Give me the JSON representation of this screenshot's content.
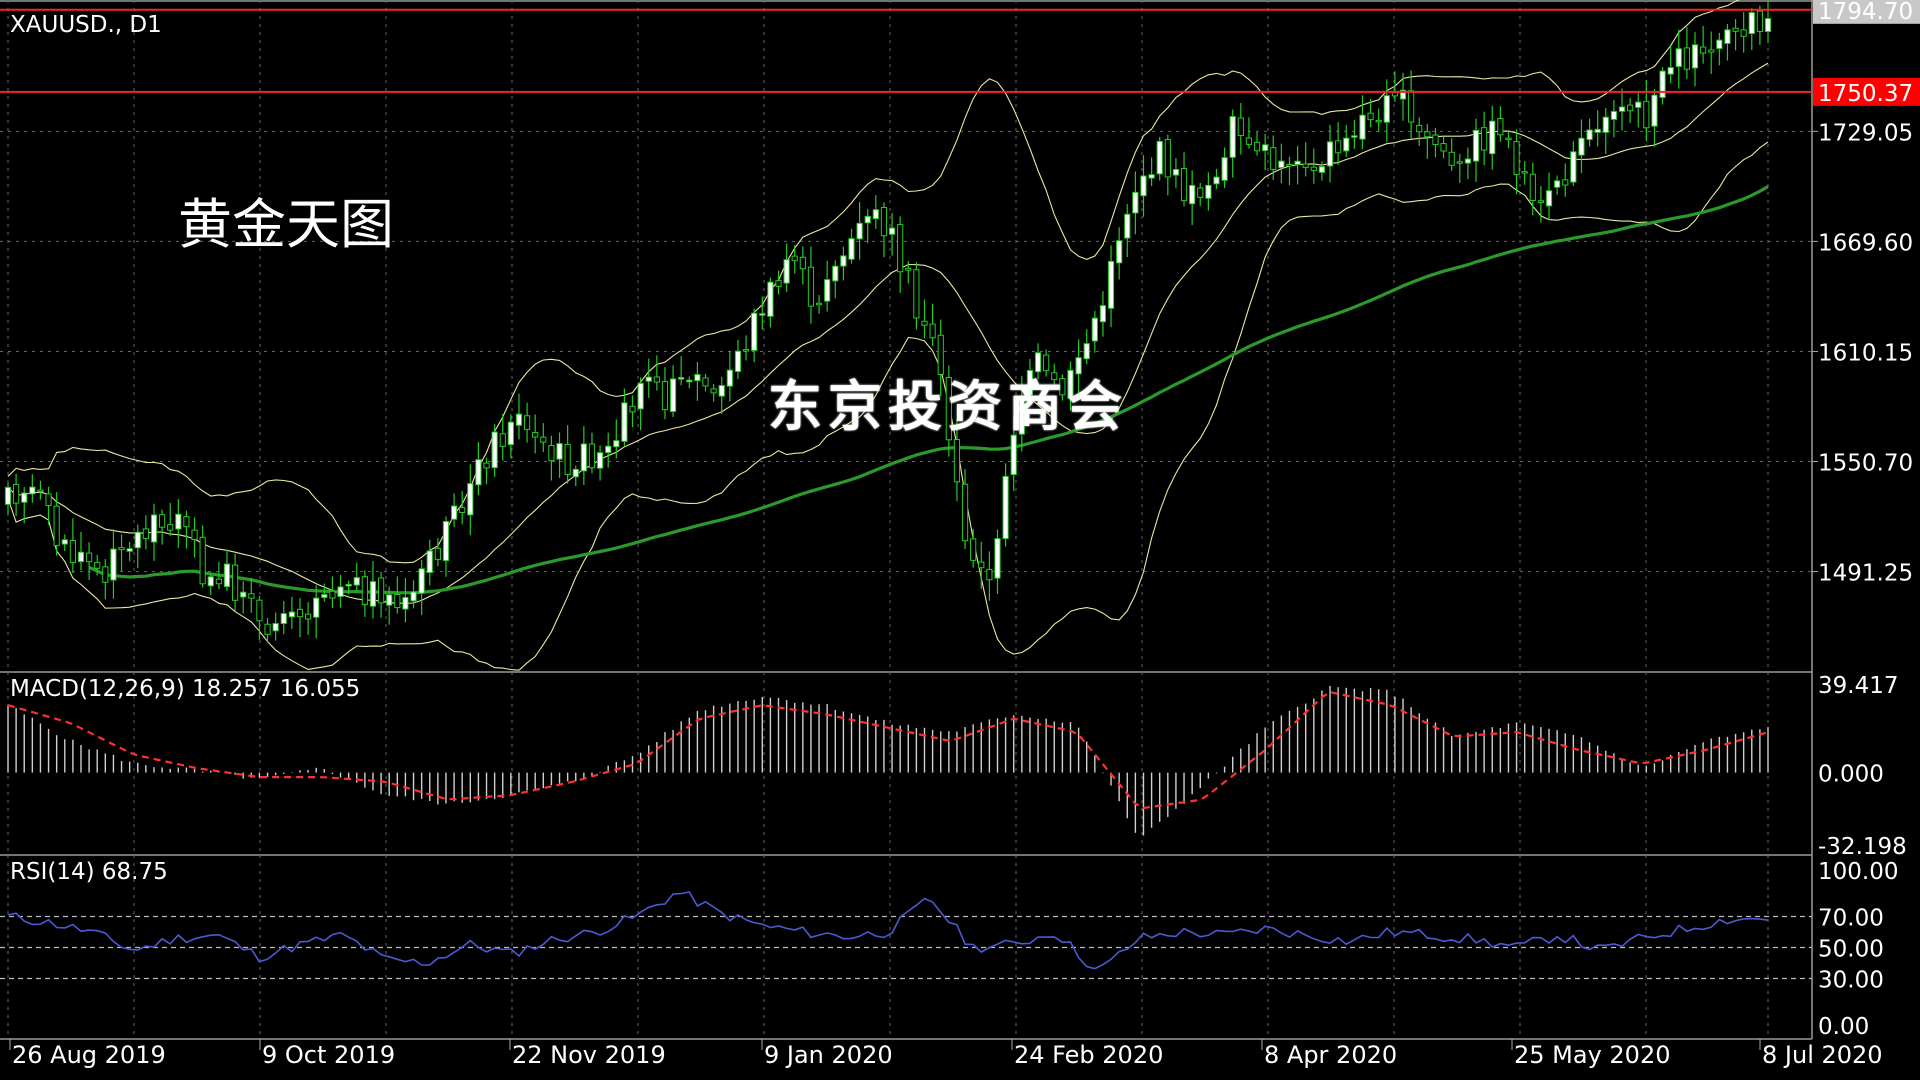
{
  "chart_data": {
    "type": "candlestick",
    "symbol_label": "XAUUSD., D1",
    "cn_title": "黄金天图",
    "watermark": "东京投资商会",
    "price_axis": {
      "labels": [
        "1729.05",
        "1669.60",
        "1610.15",
        "1550.70",
        "1491.25"
      ],
      "range": [
        1437,
        1800
      ]
    },
    "horizontal_lines": [
      {
        "label": "1794.70",
        "value": 1794.7,
        "color": "#ff2020",
        "tag_bg": "#c8c8c8",
        "tag_fg": "#000000"
      },
      {
        "label": "1750.37",
        "value": 1750.37,
        "color": "#ff2020",
        "tag_bg": "#ff0000",
        "tag_fg": "#ffffff"
      }
    ],
    "x_labels": [
      "26 Aug 2019",
      "9 Oct 2019",
      "22 Nov 2019",
      "9 Jan 2020",
      "24 Feb 2020",
      "8 Apr 2020",
      "25 May 2020",
      "8 Jul 2020"
    ],
    "ohlc_anchor_closes": [
      1530,
      1542,
      1510,
      1500,
      1492,
      1507,
      1515,
      1520,
      1490,
      1488,
      1470,
      1462,
      1465,
      1475,
      1482,
      1478,
      1474,
      1495,
      1512,
      1540,
      1562,
      1575,
      1560,
      1550,
      1556,
      1571,
      1590,
      1586,
      1600,
      1590,
      1610,
      1640,
      1665,
      1638,
      1655,
      1690,
      1678,
      1640,
      1610,
      1520,
      1480,
      1552,
      1620,
      1590,
      1610,
      1650,
      1690,
      1720,
      1700,
      1690,
      1730,
      1728,
      1710,
      1705,
      1720,
      1730,
      1740,
      1745,
      1728,
      1715,
      1722,
      1732,
      1700,
      1695,
      1712,
      1732,
      1736,
      1738,
      1764,
      1770,
      1772,
      1785,
      1790
    ],
    "colors": {
      "bull_candle": "#ffffff",
      "bear_candle": "#000000",
      "candle_outline": "#22cc22",
      "bollinger": "#e8e8a0",
      "moving_average": "#2a9a2a",
      "macd_hist": "#d0d0d0",
      "macd_signal": "#ff3030",
      "rsi_line": "#4a5ad0",
      "grid": "#666666",
      "axis_text": "#ffffff"
    },
    "macd": {
      "title": "MACD(12,26,9) 18.257 16.055",
      "axis_labels": [
        "39.417",
        "0.000",
        "-32.198"
      ],
      "range": [
        -32.198,
        39.417
      ],
      "hist_anchors": [
        30,
        14,
        4,
        1,
        -3,
        2,
        -10,
        -14,
        -10,
        -4,
        8,
        28,
        34,
        30,
        22,
        18,
        26,
        22,
        -30,
        -6,
        20,
        38,
        36,
        16,
        22,
        16,
        2,
        14,
        20
      ],
      "signal_anchors": [
        30,
        22,
        8,
        2,
        -2,
        -2,
        -4,
        -12,
        -10,
        -4,
        4,
        24,
        30,
        26,
        20,
        14,
        24,
        18,
        -16,
        -12,
        10,
        36,
        30,
        16,
        18,
        10,
        4,
        10,
        18
      ]
    },
    "rsi": {
      "title": "RSI(14) 68.75",
      "axis_labels": [
        "100.00",
        "70.00",
        "50.00",
        "30.00",
        "0.00"
      ],
      "levels": [
        70,
        50,
        30
      ],
      "range": [
        0,
        100
      ],
      "anchors": [
        70,
        66,
        60,
        48,
        56,
        58,
        44,
        52,
        58,
        42,
        40,
        52,
        46,
        55,
        60,
        70,
        86,
        72,
        64,
        60,
        57,
        60,
        82,
        50,
        52,
        60,
        34,
        56,
        60,
        58,
        62,
        58,
        54,
        60,
        58,
        55,
        50,
        58,
        48,
        56,
        62,
        68,
        69
      ]
    }
  }
}
